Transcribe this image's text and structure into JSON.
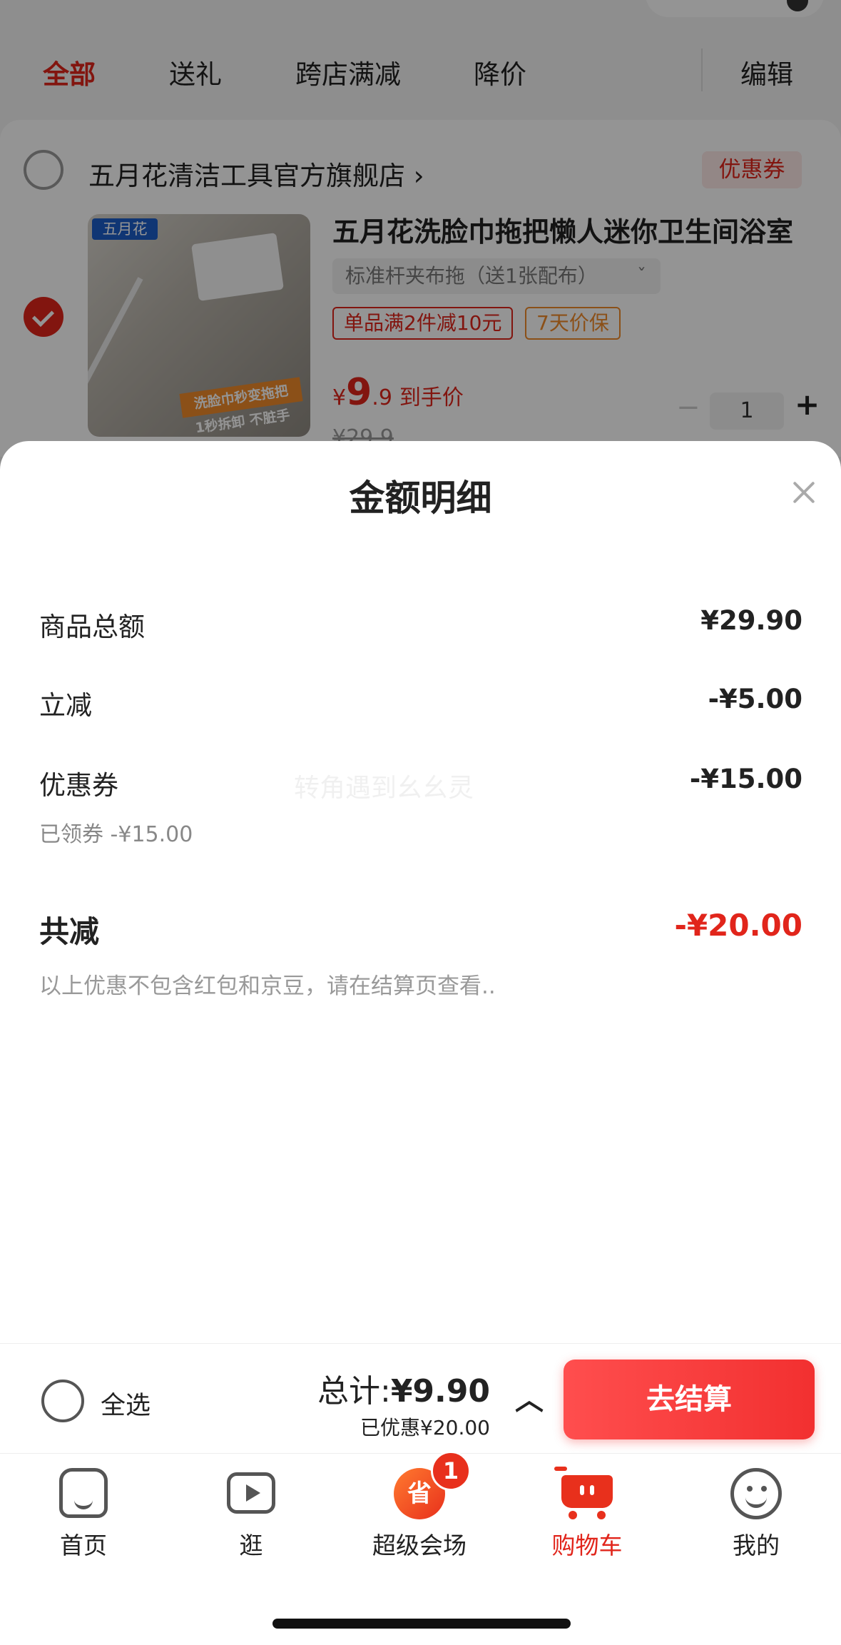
{
  "tabs": [
    {
      "label": "全部",
      "active": true
    },
    {
      "label": "送礼",
      "active": false
    },
    {
      "label": "跨店满减",
      "active": false
    },
    {
      "label": "降价",
      "active": false
    }
  ],
  "edit_label": "编辑",
  "shop": {
    "name": "五月花清洁工具官方旗舰店",
    "name_chevron": "›",
    "coupon_tag": "优惠券"
  },
  "product": {
    "image_logo": "五月花",
    "image_banner": "洗脸巾秒变拖把",
    "image_sub": "1秒拆卸 不脏手",
    "title": "五月花洗脸巾拖把懒人迷你卫生间浴室",
    "spec": "标准杆夹布拖（送1张配布）",
    "spec_chevron": "ˇ",
    "promo_tags": [
      "单品满2件减10元",
      "7天价保"
    ],
    "price_symbol": "¥",
    "price_int": "9",
    "price_dec": ".9",
    "price_label": "到手价",
    "original_price": "¥29.9",
    "quantity": "1",
    "minus": "−",
    "plus": "+"
  },
  "sheet": {
    "title": "金额明细",
    "rows": [
      {
        "label": "商品总额",
        "value": "¥29.90"
      },
      {
        "label": "立减",
        "value": "-¥5.00"
      },
      {
        "label": "优惠券",
        "value": "-¥15.00",
        "sub": "已领券 -¥15.00"
      }
    ],
    "total_label": "共减",
    "total_value": "-¥20.00",
    "note": "以上优惠不包含红包和京豆，请在结算页查看..",
    "watermark": "转角遇到幺幺灵"
  },
  "checkout": {
    "select_all": "全选",
    "total_prefix": "总计:",
    "total_value": "¥9.90",
    "saved": "已优惠¥20.00",
    "expand_icon": "︿",
    "pay_button": "去结算"
  },
  "nav": [
    {
      "label": "首页",
      "icon": "home-icon"
    },
    {
      "label": "逛",
      "icon": "video-icon"
    },
    {
      "label": "超级会场",
      "icon": "super-venue-icon",
      "badge": "1",
      "glyph": "省"
    },
    {
      "label": "购物车",
      "icon": "cart-icon",
      "active": true
    },
    {
      "label": "我的",
      "icon": "profile-icon"
    }
  ],
  "colors": {
    "accent": "#e1251b",
    "overlay": "rgba(0,0,0,0.42)"
  }
}
